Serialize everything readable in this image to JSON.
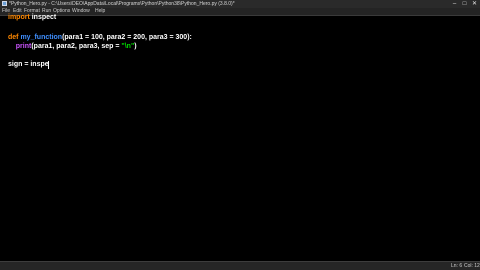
{
  "window": {
    "title": "*Python_Hero.py - C:\\Users\\DEO\\AppData\\Local\\Programs\\Python\\Python38\\Python_Hero.py (3.8.0)*",
    "controls": [
      "–",
      "□",
      "✕"
    ]
  },
  "menu": [
    "File",
    "Edit",
    "Format",
    "Run",
    "Options",
    "Window",
    "Help"
  ],
  "code": {
    "line1": {
      "kw": "import",
      "rest": " inspect"
    },
    "line3": {
      "kw": "def",
      "name": "my_function",
      "rest": "(para1 = 100, para2 = 200, para3 = 300):"
    },
    "line4": {
      "indent": "    ",
      "builtin": "print",
      "pre": "(para1, para2, para3, sep = ",
      "str": "\"\\n\"",
      "post": ")"
    },
    "line7": "sign = inspe"
  },
  "status": {
    "line": "Ln: 6",
    "col": "Col: 12"
  },
  "colors": {
    "keyword": "#ff8800",
    "function_name": "#3f8fff",
    "builtin": "#cc55ff",
    "string": "#00dd00",
    "background": "#000000"
  }
}
